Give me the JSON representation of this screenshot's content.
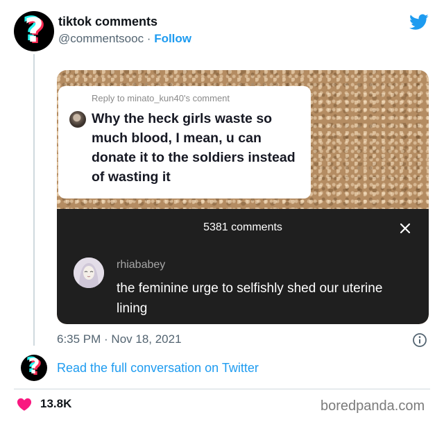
{
  "tweet": {
    "display_name": "tiktok comments",
    "handle": "@commentsooc",
    "separator": " · ",
    "follow_label": "Follow",
    "timestamp": "6:35 PM · Nov 18, 2021",
    "read_link": "Read the full conversation on Twitter",
    "like_count": "13.8K"
  },
  "tiktok": {
    "reply_to": "Reply to minato_kun40's comment",
    "reply_text": "Why the heck girls waste so much blood, I mean, u can donate it to the soldiers instead of wasting it",
    "comments_count": "5381 comments",
    "commenter": "rhiababey",
    "comment": "the feminine urge to selfishly shed our uterine lining"
  },
  "watermark": "boredpanda.com",
  "colors": {
    "twitter_blue": "#1d9bf0",
    "heart_red": "#f91880",
    "panel_bg": "#1f1f1f",
    "tiktok_cyan": "#25f4ee",
    "tiktok_red": "#fe2c55"
  },
  "icons": {
    "brand": "twitter-bird-icon",
    "close": "close-icon",
    "info": "info-icon",
    "like": "heart-icon"
  }
}
